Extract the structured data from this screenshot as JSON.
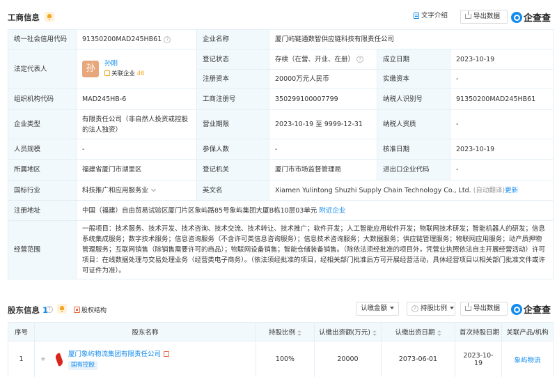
{
  "business": {
    "title": "工商信息",
    "text_intro_btn": "文字介绍",
    "export_btn": "导出数据",
    "logo_text": "企查查",
    "rows": {
      "credit_code_label": "统一社会信用代码",
      "credit_code_value": "91350200MAD245HB61",
      "company_name_label": "企业名称",
      "company_name_value": "厦门屿链通数智供应链科技有限责任公司",
      "legal_rep_label": "法定代表人",
      "legal_rep_avatar": "孙",
      "legal_rep_name": "孙刚",
      "legal_rep_related_label": "关联企业",
      "legal_rep_related_count": "46",
      "reg_status_label": "登记状态",
      "reg_status_value": "存续（在营、开业、在册）",
      "est_date_label": "成立日期",
      "est_date_value": "2023-10-19",
      "reg_capital_label": "注册资本",
      "reg_capital_value": "20000万元人民币",
      "paid_capital_label": "实缴资本",
      "paid_capital_value": "-",
      "org_code_label": "组织机构代码",
      "org_code_value": "MAD245HB-6",
      "biz_reg_no_label": "工商注册号",
      "biz_reg_no_value": "350299100007799",
      "taxpayer_id_label": "纳税人识别号",
      "taxpayer_id_value": "91350200MAD245HB61",
      "ent_type_label": "企业类型",
      "ent_type_value": "有限责任公司（非自然人投资或控股的法人独资）",
      "biz_term_label": "营业期限",
      "biz_term_value": "2023-10-19 至 9999-12-31",
      "taxpayer_qual_label": "纳税人资质",
      "taxpayer_qual_value": "-",
      "staff_size_label": "人员规模",
      "staff_size_value": "-",
      "insured_label": "参保人数",
      "insured_value": "-",
      "approval_date_label": "核准日期",
      "approval_date_value": "2023-10-19",
      "region_label": "所属地区",
      "region_value": "福建省厦门市湖里区",
      "reg_authority_label": "登记机关",
      "reg_authority_value": "厦门市市场监督管理局",
      "ie_code_label": "进出口企业代码",
      "ie_code_value": "-",
      "industry_label": "国标行业",
      "industry_value": "科技推广和应用服务业",
      "en_name_label": "英文名",
      "en_name_value": "Xiamen Yulintong Shuzhi Supply Chain Technology Co., Ltd.",
      "en_name_note": "(自动翻译)",
      "en_name_update": "更新",
      "address_label": "注册地址",
      "address_value": "中国（福建）自由贸易试验区厦门片区象屿路85号象屿集团大厦B栋10层03单元",
      "address_link": "附近企业",
      "scope_label": "经营范围",
      "scope_value": "一般项目：技术服务、技术开发、技术咨询、技术交流、技术转让、技术推广；软件开发；人工智能应用软件开发；物联网技术研发；智能机器人的研发；信息系统集成服务；数字技术服务；信息咨询服务（不含许可类信息咨询服务）；信息技术咨询服务；大数据服务；供应链管理服务；物联网应用服务；动产质押物管理服务；互联网销售（除销售需要许可的商品）；物联网设备销售；智能仓储装备销售。（除依法须经批准的项目外，凭营业执照依法自主开展经营活动）许可项目：在线数据处理与交易处理业务（经营类电子商务）。（依法须经批准的项目，经相关部门批准后方可开展经营活动，具体经营项目以相关部门批准文件或许可证件为准）。"
    }
  },
  "shareholders": {
    "title": "股东信息",
    "count": "1",
    "equity_structure": "股权结构",
    "sort_amount_btn": "认缴金额",
    "filter_ratio_btn": "持股比例",
    "export_btn": "导出数据",
    "logo_text": "企查查",
    "columns": {
      "no": "序号",
      "name": "股东名称",
      "ratio": "持股比例",
      "amount": "认缴出资额(万元)",
      "date": "认缴出资日期",
      "first_date": "首次持股日期",
      "related": "关联产品/机构"
    },
    "rows": [
      {
        "no": "1",
        "expand": "+",
        "name": "厦门象屿物流集团有限责任公司",
        "tag": "国有控股",
        "ratio": "100%",
        "amount": "20000",
        "date": "2073-06-01",
        "first_date": "2023-10-19",
        "related": "象屿物流"
      }
    ]
  },
  "colors": {
    "accent": "#128bed",
    "label_bg": "#f2f9fc",
    "border": "#e4eef6",
    "orange": "#f5a623"
  }
}
